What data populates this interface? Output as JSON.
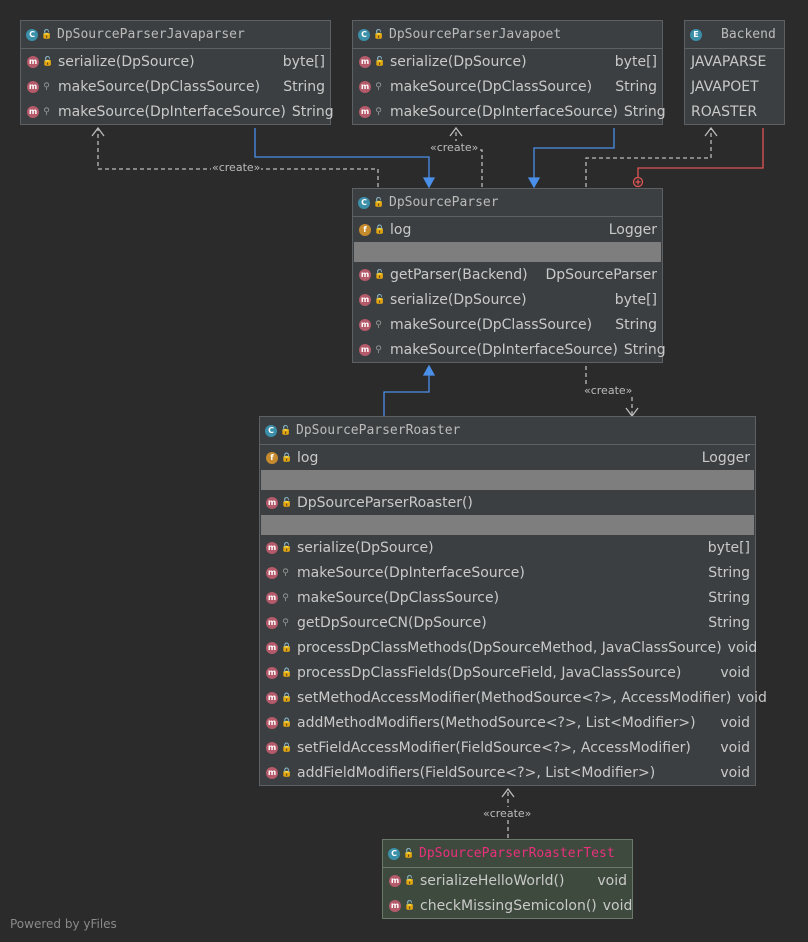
{
  "classes": [
    {
      "id": "javaparser",
      "title": "DpSourceParserJavaparser",
      "icon": "C",
      "icon_name": "class-icon",
      "sections": [
        [
          {
            "name": "serialize(DpSource)",
            "type": "byte[]",
            "vis": "public"
          },
          {
            "name": "makeSource(DpClassSource)",
            "type": "String",
            "vis": "package"
          },
          {
            "name": "makeSource(DpInterfaceSource)",
            "type": "String",
            "vis": "package"
          }
        ]
      ]
    },
    {
      "id": "javapoet",
      "title": "DpSourceParserJavapoet",
      "icon": "C",
      "icon_name": "class-icon",
      "sections": [
        [
          {
            "name": "serialize(DpSource)",
            "type": "byte[]",
            "vis": "public"
          },
          {
            "name": "makeSource(DpClassSource)",
            "type": "String",
            "vis": "package"
          },
          {
            "name": "makeSource(DpInterfaceSource)",
            "type": "String",
            "vis": "package"
          }
        ]
      ]
    },
    {
      "id": "backend",
      "title": "Backend",
      "icon": "E",
      "icon_name": "enum-icon",
      "sections": [
        [
          {
            "name": "JAVAPARSE",
            "type": "",
            "vis": "none"
          },
          {
            "name": "JAVAPOET",
            "type": "",
            "vis": "none"
          },
          {
            "name": "ROASTER",
            "type": "",
            "vis": "none"
          }
        ]
      ]
    },
    {
      "id": "parser",
      "title": "DpSourceParser",
      "icon": "C",
      "icon_name": "abstract-class-icon",
      "sections": [
        [
          {
            "name": "log",
            "type": "Logger",
            "vis": "private",
            "kind": "field"
          }
        ],
        [],
        [
          {
            "name": "getParser(Backend)",
            "type": "DpSourceParser",
            "vis": "public"
          },
          {
            "name": "serialize(DpSource)",
            "type": "byte[]",
            "vis": "public"
          },
          {
            "name": "makeSource(DpClassSource)",
            "type": "String",
            "vis": "package"
          },
          {
            "name": "makeSource(DpInterfaceSource)",
            "type": "String",
            "vis": "package"
          }
        ]
      ]
    },
    {
      "id": "roaster",
      "title": "DpSourceParserRoaster",
      "icon": "C",
      "icon_name": "class-icon",
      "sections": [
        [
          {
            "name": "log",
            "type": "Logger",
            "vis": "private",
            "kind": "field"
          }
        ],
        [],
        [
          {
            "name": "DpSourceParserRoaster()",
            "type": "",
            "vis": "public"
          }
        ],
        [],
        [
          {
            "name": "serialize(DpSource)",
            "type": "byte[]",
            "vis": "public"
          },
          {
            "name": "makeSource(DpInterfaceSource)",
            "type": "String",
            "vis": "package"
          },
          {
            "name": "makeSource(DpClassSource)",
            "type": "String",
            "vis": "package"
          },
          {
            "name": "getDpSourceCN(DpSource)",
            "type": "String",
            "vis": "package"
          },
          {
            "name": "processDpClassMethods(DpSourceMethod, JavaClassSource)",
            "type": "void",
            "vis": "private"
          },
          {
            "name": "processDpClassFields(DpSourceField, JavaClassSource)",
            "type": "void",
            "vis": "private"
          },
          {
            "name": "setMethodAccessModifier(MethodSource<?>, AccessModifier)",
            "type": "void",
            "vis": "private"
          },
          {
            "name": "addMethodModifiers(MethodSource<?>, List<Modifier>)",
            "type": "void",
            "vis": "private"
          },
          {
            "name": "setFieldAccessModifier(FieldSource<?>, AccessModifier)",
            "type": "void",
            "vis": "private"
          },
          {
            "name": "addFieldModifiers(FieldSource<?>, List<Modifier>)",
            "type": "void",
            "vis": "private"
          }
        ]
      ]
    },
    {
      "id": "test",
      "title": "DpSourceParserRoasterTest",
      "icon": "C",
      "icon_name": "test-class-icon",
      "sections": [
        [
          {
            "name": "serializeHelloWorld()",
            "type": "void",
            "vis": "public"
          },
          {
            "name": "checkMissingSemicolon()",
            "type": "void",
            "vis": "public"
          }
        ]
      ]
    }
  ],
  "edge_labels": {
    "create_1": "«create»",
    "create_2": "«create»",
    "create_3": "«create»",
    "create_4": "«create»"
  },
  "colors": {
    "inheritance": "#4a8fe8",
    "dependency": "#bbbbbb",
    "inner": "#e05555",
    "test_title": "#e8307c"
  },
  "footer": "Powered by yFiles"
}
